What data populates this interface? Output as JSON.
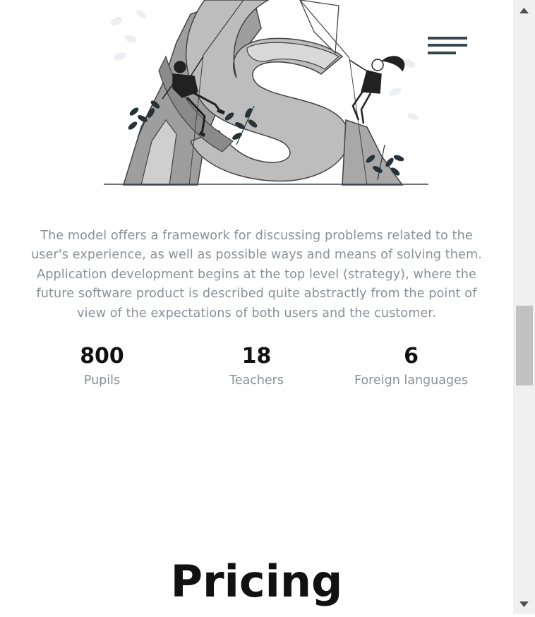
{
  "description": "The model offers a framework for discussing problems related to the user's experience, as well as possible ways and means of solving them. Application development begins at the top level (strategy), where the future software product is described quite abstractly from the point of view of the expectations of both users and the customer.",
  "stats": [
    {
      "value": "800",
      "label": "Pupils"
    },
    {
      "value": "18",
      "label": "Teachers"
    },
    {
      "value": "6",
      "label": "Foreign languages"
    }
  ],
  "pricing": {
    "heading": "Pricing"
  },
  "icons": {
    "menu": "hamburger-icon",
    "scroll_up": "triangle-up-icon",
    "scroll_down": "triangle-down-icon"
  },
  "colors": {
    "text_muted": "#8a9096",
    "text_dark": "#111111",
    "menu_icon": "#37474f",
    "scroll_track": "#f0f0f0",
    "scroll_thumb": "#c1c1c1"
  }
}
